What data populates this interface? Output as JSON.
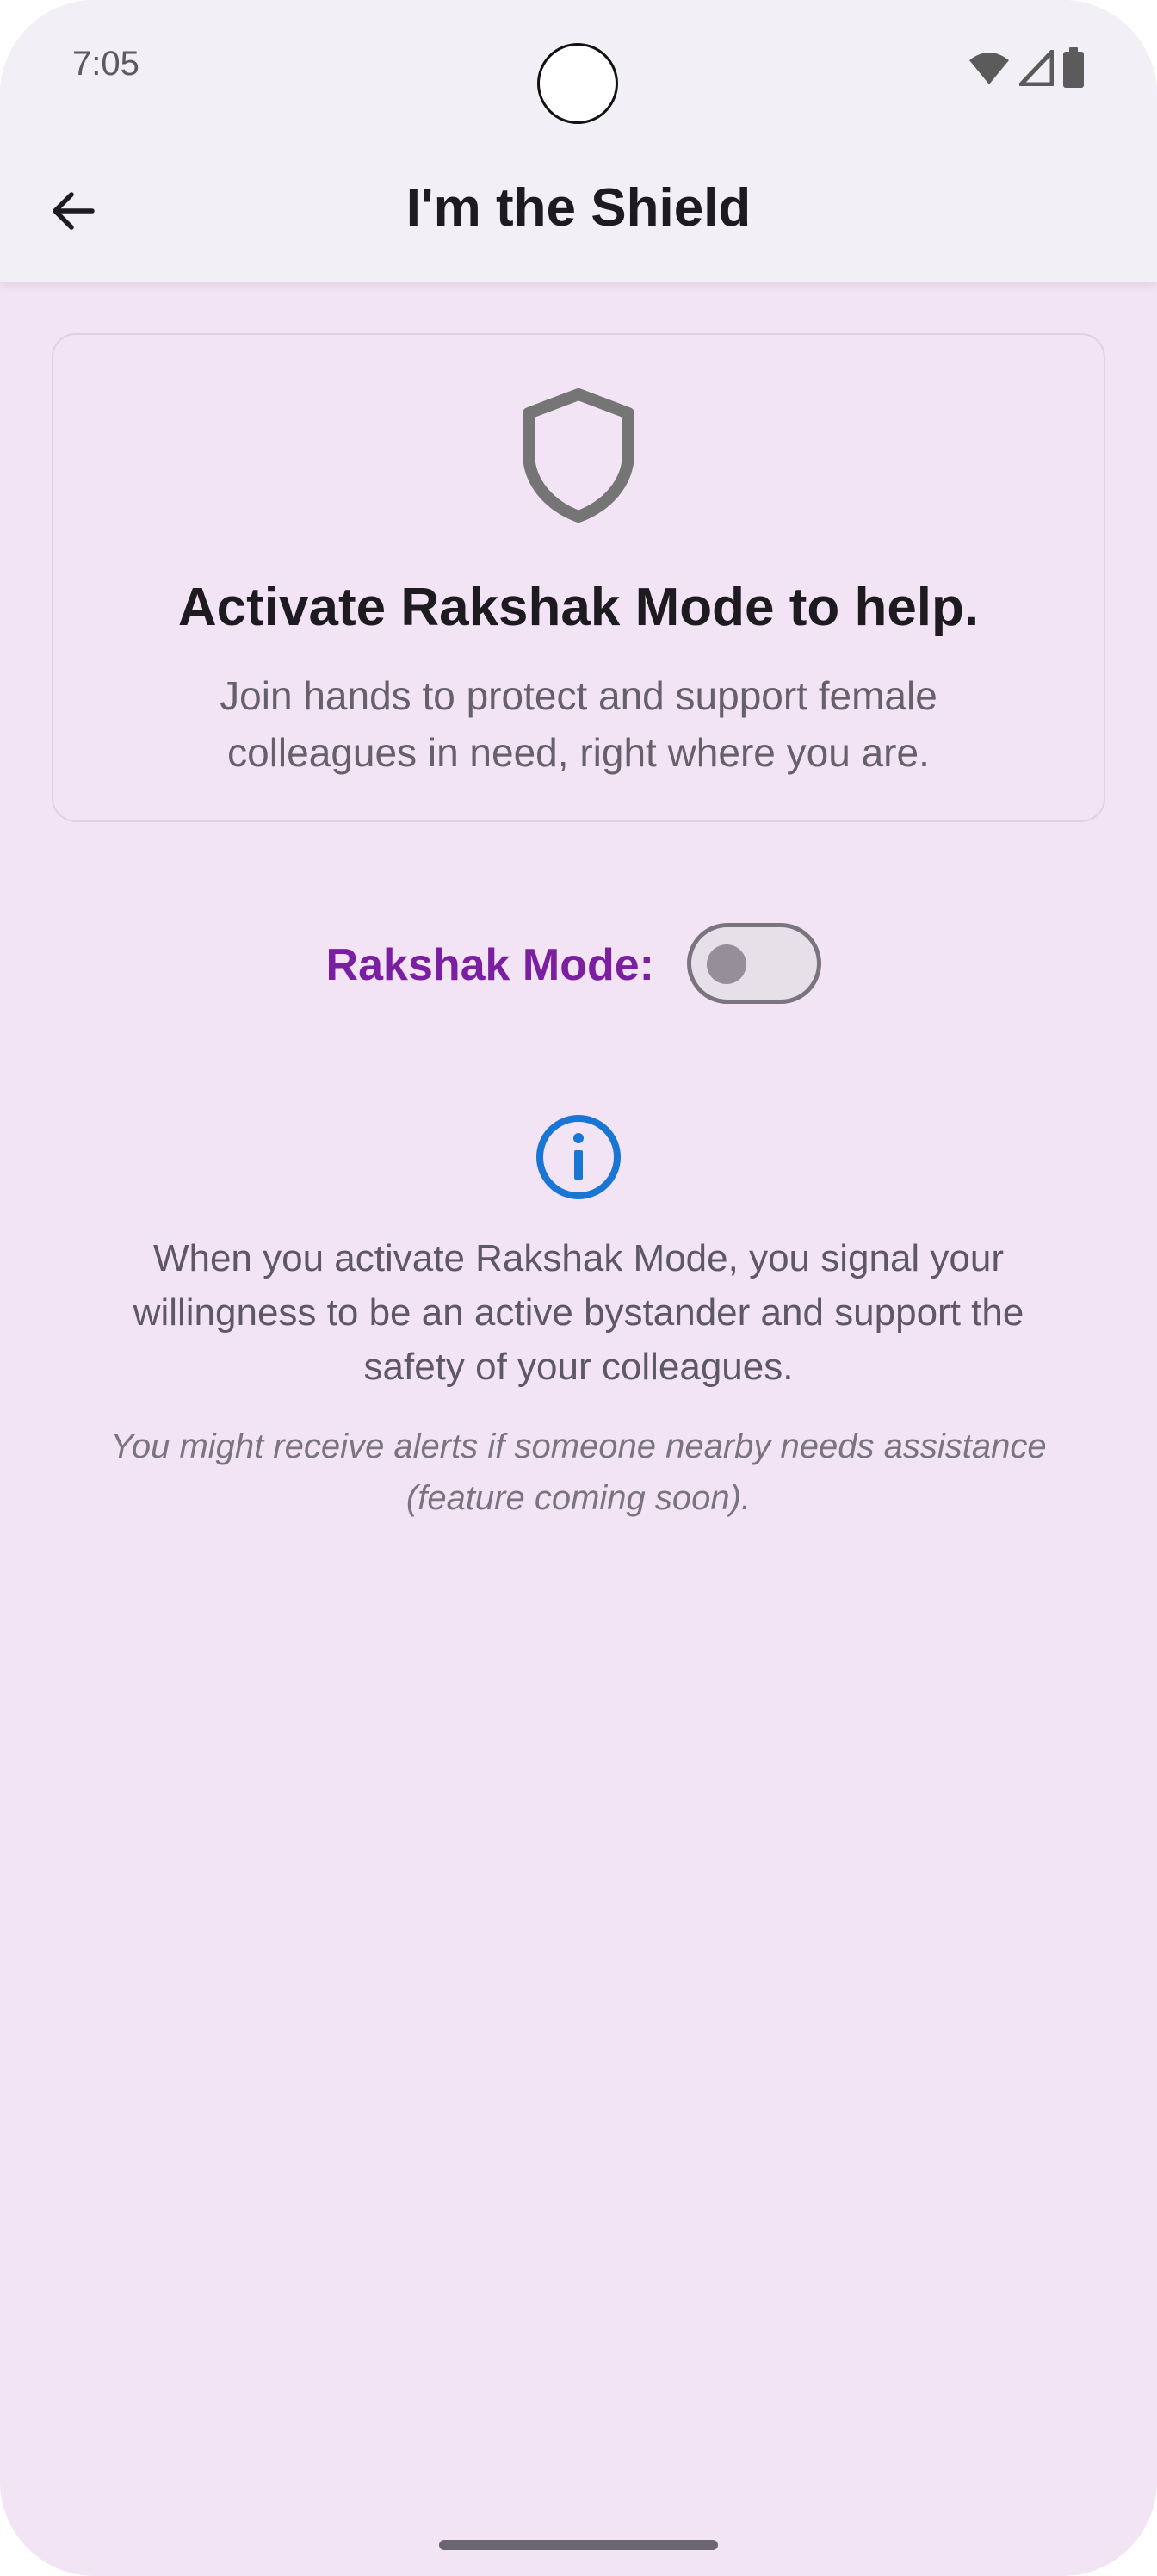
{
  "status_bar": {
    "time": "7:05",
    "icons": [
      "wifi-icon",
      "cellular-signal-icon",
      "battery-icon"
    ]
  },
  "app_bar": {
    "title": "I'm the Shield",
    "back_icon": "arrow-left-icon"
  },
  "intro_card": {
    "icon": "shield-icon",
    "heading": "Activate Rakshak Mode to help.",
    "subtitle": "Join hands to protect and support female colleagues in need, right where you are."
  },
  "rakshak_toggle": {
    "label": "Rakshak Mode:",
    "state": "off"
  },
  "info": {
    "icon": "info-icon",
    "text": "When you activate Rakshak Mode, you signal your willingness to be an active bystander and support the safety of your colleagues.",
    "note": "You might receive alerts if someone nearby needs assistance (feature coming soon)."
  },
  "colors": {
    "background": "#f2e4f4",
    "app_bar": "#f2eff7",
    "accent_label": "#7b1fa2",
    "info_icon": "#1976d2",
    "shield_icon": "#757575"
  }
}
